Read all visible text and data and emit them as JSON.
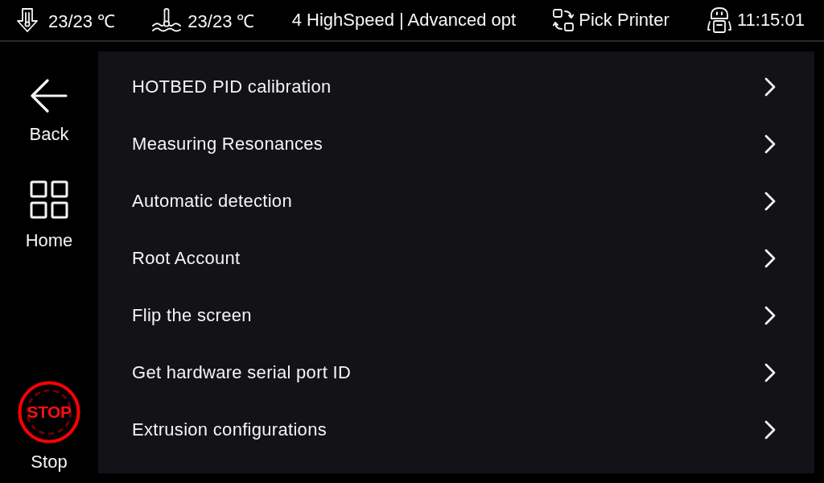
{
  "status_bar": [
    {
      "kind": "nozzle",
      "text": "23/23 ℃"
    },
    {
      "kind": "bed",
      "text": "23/23 ℃"
    },
    {
      "kind": "printer",
      "text": "4 HighSpeed | Advanced opt"
    },
    {
      "kind": "pick",
      "text": "Pick Printer"
    },
    {
      "kind": "clock",
      "text": "11:15:01"
    }
  ],
  "sidebar": {
    "top": [
      {
        "kind": "back",
        "label": "Back"
      },
      {
        "kind": "home",
        "label": "Home"
      }
    ],
    "bottom": [
      {
        "kind": "stop",
        "label": "Stop",
        "sign_text": "STOP"
      }
    ]
  },
  "menu_items": [
    {
      "label": "HOTBED PID calibration"
    },
    {
      "label": "Measuring Resonances"
    },
    {
      "label": "Automatic detection"
    },
    {
      "label": "Root Account"
    },
    {
      "label": "Flip the screen"
    },
    {
      "label": "Get hardware serial port ID"
    },
    {
      "label": "Extrusion configurations"
    }
  ]
}
